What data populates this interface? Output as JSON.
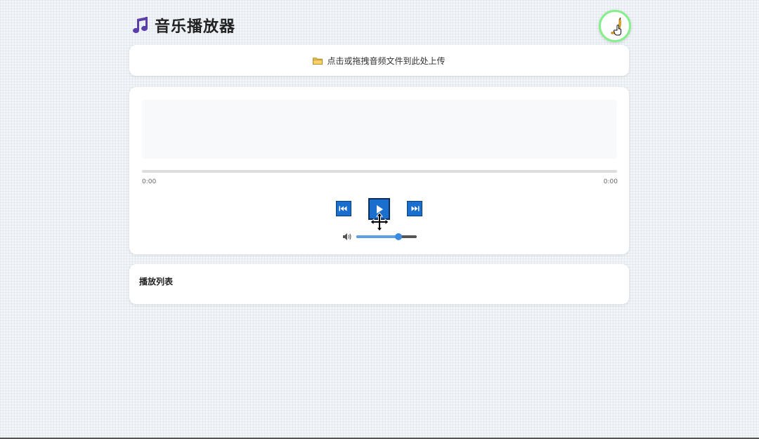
{
  "header": {
    "title": "音乐播放器",
    "icons": {
      "title": "music-note-icon",
      "theme_toggle": "banana-icon"
    }
  },
  "upload": {
    "icon": "folder-icon",
    "text": "点击或拖拽音频文件到此处上传"
  },
  "player": {
    "progress": 0,
    "time_current": "0:00",
    "time_total": "0:00",
    "controls": {
      "prev_icon": "skip-previous-icon",
      "play_icon": "play-icon",
      "next_icon": "skip-next-icon"
    },
    "volume": {
      "icon": "speaker-icon",
      "level": 0.7
    }
  },
  "playlist": {
    "title": "播放列表",
    "items": []
  },
  "colors": {
    "accent": "#1a6fce",
    "slider_fill": "#5a9fe8",
    "toggle_ring": "#86ef8c",
    "note_icon": "#5b3ea8"
  }
}
